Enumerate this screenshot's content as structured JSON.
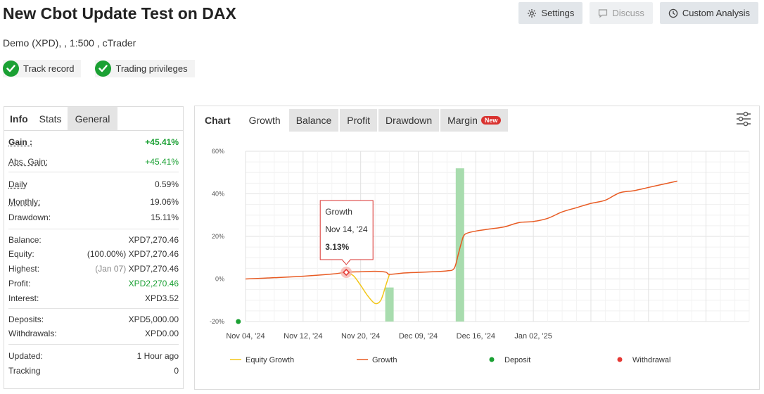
{
  "header": {
    "title": "New Cbot Update Test on DAX",
    "subtitle": "Demo (XPD), , 1:500 , cTrader",
    "badges": [
      "Track record",
      "Trading privileges"
    ],
    "buttons": {
      "settings": "Settings",
      "discuss": "Discuss",
      "custom": "Custom Analysis"
    }
  },
  "left_tabs": [
    "Info",
    "Stats",
    "General"
  ],
  "stats": {
    "gain": {
      "label": "Gain :",
      "value": "+45.41%"
    },
    "abs_gain": {
      "label": "Abs. Gain:",
      "value": "+45.41%"
    },
    "daily": {
      "label": "Daily",
      "value": "0.59%"
    },
    "monthly": {
      "label": "Monthly:",
      "value": "19.06%"
    },
    "drawdown": {
      "label": "Drawdown:",
      "value": "15.11%"
    },
    "balance": {
      "label": "Balance:",
      "value": "XPD7,270.46"
    },
    "equity": {
      "label": "Equity:",
      "note": "(100.00%)",
      "value": "XPD7,270.46"
    },
    "highest": {
      "label": "Highest:",
      "note": "(Jan 07)",
      "value": "XPD7,270.46"
    },
    "profit": {
      "label": "Profit:",
      "value": "XPD2,270.46"
    },
    "interest": {
      "label": "Interest:",
      "value": "XPD3.52"
    },
    "deposits": {
      "label": "Deposits:",
      "value": "XPD5,000.00"
    },
    "withdrawals": {
      "label": "Withdrawals:",
      "value": "XPD0.00"
    },
    "updated": {
      "label": "Updated:",
      "value": "1 Hour ago"
    },
    "tracking": {
      "label": "Tracking",
      "value": "0"
    }
  },
  "chart_tabs": {
    "chart": "Chart",
    "growth": "Growth",
    "balance": "Balance",
    "profit": "Profit",
    "drawdown": "Drawdown",
    "margin": "Margin",
    "new_badge": "New"
  },
  "colors": {
    "growth": "#e85b23",
    "equity": "#f2c618",
    "deposit": "#1aa033",
    "withdrawal": "#e53935",
    "bar": "#a8dcae"
  },
  "chart_data": {
    "type": "line",
    "ylim": [
      -20,
      60
    ],
    "yticks": [
      -20,
      0,
      20,
      40,
      60
    ],
    "ytick_labels": [
      "-20%",
      "0%",
      "20%",
      "40%",
      "60%"
    ],
    "xlim": [
      0,
      70
    ],
    "xticks": [
      0,
      8,
      16,
      24,
      32,
      40
    ],
    "xtick_labels": [
      "Nov 04, '24",
      "Nov 12, '24",
      "Nov 20, '24",
      "Dec 09, '24",
      "Dec 16, '24",
      "Jan 02, '25"
    ],
    "series": [
      {
        "name": "Growth",
        "points": [
          [
            0,
            0
          ],
          [
            4,
            0.6
          ],
          [
            8,
            1.3
          ],
          [
            12,
            2.3
          ],
          [
            14,
            3.13
          ],
          [
            16,
            3.4
          ],
          [
            18,
            3.6
          ],
          [
            19.5,
            3.2
          ],
          [
            20,
            2.2
          ],
          [
            22,
            2.8
          ],
          [
            24,
            3.1
          ],
          [
            26,
            3.4
          ],
          [
            28,
            3.8
          ],
          [
            29,
            5
          ],
          [
            29.6,
            12
          ],
          [
            30,
            17
          ],
          [
            30.5,
            21
          ],
          [
            32,
            22.5
          ],
          [
            34,
            23.5
          ],
          [
            36,
            24.5
          ],
          [
            38,
            26.5
          ],
          [
            40,
            27
          ],
          [
            42,
            28.5
          ],
          [
            44,
            31.5
          ],
          [
            46,
            33.5
          ],
          [
            48,
            35.5
          ],
          [
            50,
            37
          ],
          [
            52,
            40.5
          ],
          [
            54,
            41.5
          ],
          [
            56,
            43
          ],
          [
            58,
            44.5
          ],
          [
            60,
            46
          ]
        ]
      },
      {
        "name": "Equity Growth",
        "points": [
          [
            14,
            3.13
          ],
          [
            15,
            1.5
          ],
          [
            16,
            -3
          ],
          [
            17,
            -8
          ],
          [
            18,
            -11.5
          ],
          [
            18.8,
            -10
          ],
          [
            19.5,
            -3
          ],
          [
            20,
            2.2
          ]
        ]
      }
    ],
    "bars": [
      {
        "x": 20,
        "value": -4,
        "base": -20
      },
      {
        "x": 29.8,
        "value": 52,
        "base": -20
      }
    ],
    "deposit_points": [
      [
        -1,
        -20
      ]
    ],
    "tooltip": {
      "series": "Growth",
      "date": "Nov 14, '24",
      "value": "3.13%",
      "x": 14,
      "y": 3.13
    },
    "legend": [
      "Equity Growth",
      "Growth",
      "Deposit",
      "Withdrawal"
    ]
  }
}
